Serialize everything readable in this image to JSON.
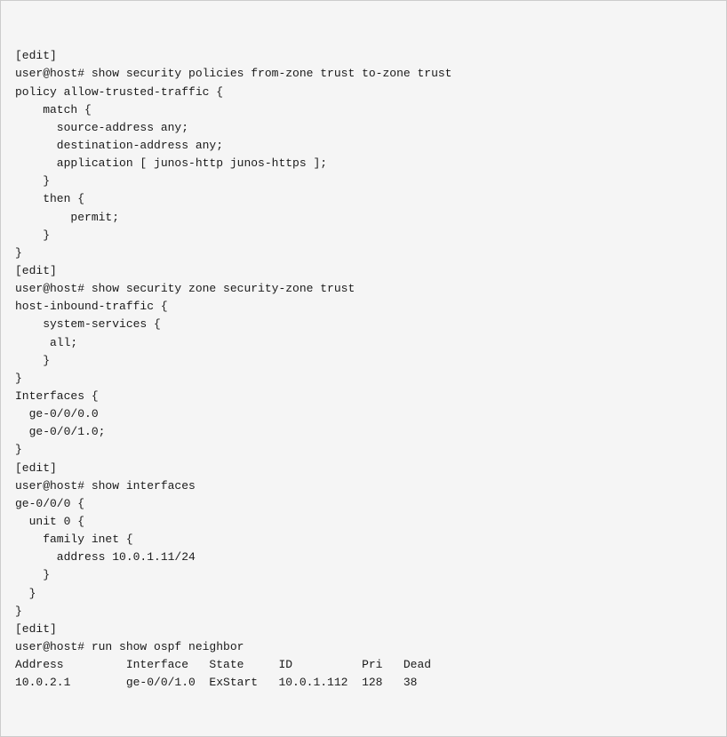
{
  "terminal": {
    "background": "#f5f5f5",
    "text_color": "#1a1a1a",
    "lines": [
      "[edit]",
      "user@host# show security policies from-zone trust to-zone trust",
      "policy allow-trusted-traffic {",
      "    match {",
      "      source-address any;",
      "      destination-address any;",
      "      application [ junos-http junos-https ];",
      "    }",
      "    then {",
      "        permit;",
      "    }",
      "}",
      "[edit]",
      "user@host# show security zone security-zone trust",
      "host-inbound-traffic {",
      "    system-services {",
      "     all;",
      "    }",
      "}",
      "Interfaces {",
      "  ge-0/0/0.0",
      "  ge-0/0/1.0;",
      "}",
      "[edit]",
      "user@host# show interfaces",
      "ge-0/0/0 {",
      "  unit 0 {",
      "    family inet {",
      "      address 10.0.1.11/24",
      "    }",
      "  }",
      "}",
      "[edit]",
      "user@host# run show ospf neighbor",
      "Address         Interface   State     ID          Pri   Dead",
      "10.0.2.1        ge-0/0/1.0  ExStart   10.0.1.112  128   38"
    ]
  }
}
